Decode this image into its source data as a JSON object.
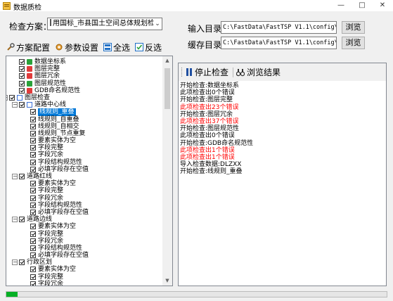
{
  "window": {
    "title": "数据质检",
    "controls": [
      "—",
      "□",
      "✕"
    ]
  },
  "scheme": {
    "label": "检查方案：",
    "value": "用国标_市县国土空间总体规划检查方案"
  },
  "toolbar": {
    "scheme_config": "方案配置",
    "param_settings": "参数设置",
    "select_all": "全选",
    "invert_select": "反选"
  },
  "tree": {
    "nodes": [
      {
        "label": "数据坐标系",
        "depth": 2,
        "icon": "check-item-icon",
        "color": "#2aa13a"
      },
      {
        "label": "图层完整",
        "depth": 2,
        "icon": "check-item-icon",
        "color": "#e03b3b"
      },
      {
        "label": "图层冗余",
        "depth": 2,
        "icon": "check-item-icon",
        "color": "#e03b3b"
      },
      {
        "label": "图层规范性",
        "depth": 2,
        "icon": "check-item-icon",
        "color": "#2aa13a"
      },
      {
        "label": "GDB命名规范性",
        "depth": 2,
        "icon": "check-item-icon",
        "color": "#e03b3b"
      },
      {
        "label": "图层检查",
        "depth": 1,
        "expander": "−",
        "icon": "folder-icon",
        "color": "#3a6fd8"
      },
      {
        "label": "道路中心线",
        "depth": 2,
        "expander": "−",
        "icon": "folder-icon",
        "color": "#3a6fd8"
      },
      {
        "label": "线规则_重叠",
        "depth": 3,
        "selected": true
      },
      {
        "label": "线规则_自重叠",
        "depth": 3
      },
      {
        "label": "线规则_自相交",
        "depth": 3
      },
      {
        "label": "线规则_节点重复",
        "depth": 3
      },
      {
        "label": "要素实体为空",
        "depth": 3
      },
      {
        "label": "字段完整",
        "depth": 3
      },
      {
        "label": "字段冗余",
        "depth": 3
      },
      {
        "label": "字段结构规范性",
        "depth": 3
      },
      {
        "label": "必填字段存在空值",
        "depth": 3
      },
      {
        "label": "道路红线",
        "depth": 2,
        "expander": "−"
      },
      {
        "label": "要素实体为空",
        "depth": 3
      },
      {
        "label": "字段完整",
        "depth": 3
      },
      {
        "label": "字段冗余",
        "depth": 3
      },
      {
        "label": "字段结构规范性",
        "depth": 3
      },
      {
        "label": "必填字段存在空值",
        "depth": 3
      },
      {
        "label": "道路边线",
        "depth": 2,
        "expander": "−"
      },
      {
        "label": "要素实体为空",
        "depth": 3
      },
      {
        "label": "字段完整",
        "depth": 3
      },
      {
        "label": "字段冗余",
        "depth": 3
      },
      {
        "label": "字段结构规范性",
        "depth": 3
      },
      {
        "label": "必填字段存在空值",
        "depth": 3
      },
      {
        "label": "行政区划",
        "depth": 2,
        "expander": "−"
      },
      {
        "label": "要素实体为空",
        "depth": 3
      },
      {
        "label": "字段完整",
        "depth": 3
      },
      {
        "label": "字段冗余",
        "depth": 3
      }
    ]
  },
  "paths": {
    "input_label": "输入目录：",
    "input_value": "C:\\FastData\\FastTSP V1.1\\config\\Sam",
    "output_label": "缓存目录：",
    "output_value": "C:\\FastData\\FastTSP V1.1\\config\\Sam",
    "browse": "浏览"
  },
  "results_toolbar": {
    "stop": "停止检查",
    "browse_results": "浏览结果"
  },
  "log": [
    {
      "text": "开始检查:数据坐标系",
      "error": false
    },
    {
      "text": "此项检查出0个错误",
      "error": false
    },
    {
      "text": "开始检查:图层完整",
      "error": false
    },
    {
      "text": "此项检查出23个错误",
      "error": true
    },
    {
      "text": "开始检查:图层冗余",
      "error": false
    },
    {
      "text": "此项检查出37个错误",
      "error": true
    },
    {
      "text": "开始检查:图层规范性",
      "error": false
    },
    {
      "text": "此项检查出0个错误",
      "error": false
    },
    {
      "text": "开始检查:GDB命名规范性",
      "error": false
    },
    {
      "text": "此项检查出1个错误",
      "error": true
    },
    {
      "text": "此项检查出1个错误",
      "error": true
    },
    {
      "text": "导入检查数据:DLZXX",
      "error": false
    },
    {
      "text": "开始检查:线规则_重叠",
      "error": false
    }
  ],
  "colors": {
    "selection": "#0078d7",
    "error_text": "#ff0000",
    "progress": "#06b025"
  },
  "progress": {
    "fraction": 0.03
  }
}
